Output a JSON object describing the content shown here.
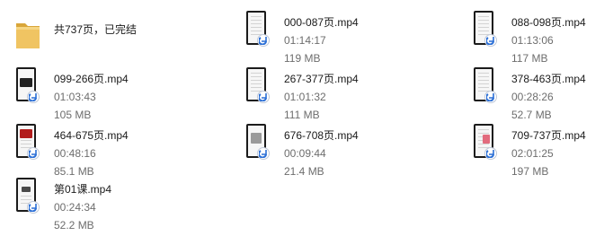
{
  "items": [
    {
      "type": "folder",
      "name": "共737页，已完结",
      "duration": "",
      "size": ""
    },
    {
      "type": "video",
      "name": "000-087页.mp4",
      "duration": "01:14:17",
      "size": "119 MB",
      "thumb": "lines"
    },
    {
      "type": "video",
      "name": "088-098页.mp4",
      "duration": "01:13:06",
      "size": "117 MB",
      "thumb": "lines"
    },
    {
      "type": "video",
      "name": "099-266页.mp4",
      "duration": "01:03:43",
      "size": "105 MB",
      "thumb": "dark"
    },
    {
      "type": "video",
      "name": "267-377页.mp4",
      "duration": "01:01:32",
      "size": "111 MB",
      "thumb": "lines"
    },
    {
      "type": "video",
      "name": "378-463页.mp4",
      "duration": "00:28:26",
      "size": "52.7 MB",
      "thumb": "lines"
    },
    {
      "type": "video",
      "name": "464-675页.mp4",
      "duration": "00:48:16",
      "size": "85.1 MB",
      "thumb": "red"
    },
    {
      "type": "video",
      "name": "676-708页.mp4",
      "duration": "00:09:44",
      "size": "21.4 MB",
      "thumb": "gray"
    },
    {
      "type": "video",
      "name": "709-737页.mp4",
      "duration": "02:01:25",
      "size": "197 MB",
      "thumb": "pink"
    },
    {
      "type": "video",
      "name": "第01课.mp4",
      "duration": "00:24:34",
      "size": "52.2 MB",
      "thumb": "blk"
    }
  ],
  "colors": {
    "folder": "#e9b84a",
    "badge_blue": "#2b6fd6",
    "meta_text": "#6d6d6d"
  },
  "icons": {
    "folder": "folder-icon",
    "video": "video-file-icon",
    "badge": "media-player-badge-icon"
  }
}
